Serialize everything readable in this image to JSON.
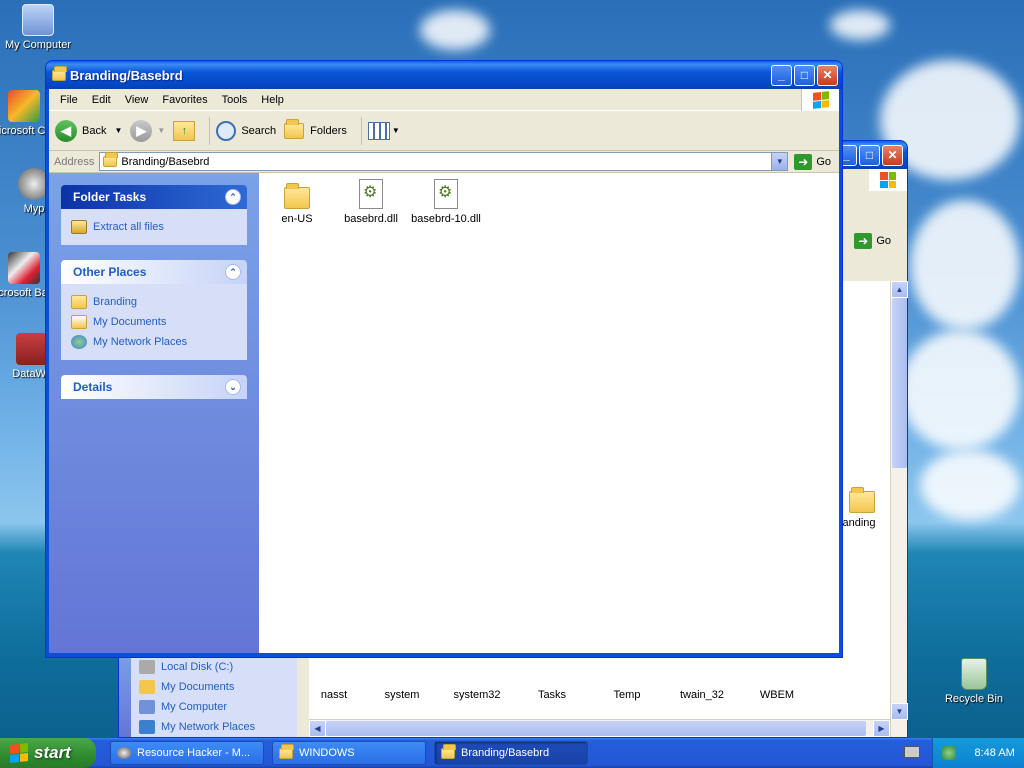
{
  "desktop": {
    "icons": [
      {
        "label": "My Computer"
      },
      {
        "label": "Microsoft C++"
      },
      {
        "label": "Myp"
      },
      {
        "label": "Microsoft Basic"
      },
      {
        "label": "DataWa"
      },
      {
        "label": "Recycle Bin"
      }
    ]
  },
  "back_window": {
    "go_label": "Go",
    "left_links": [
      "Local Disk (C:)",
      "My Documents",
      "My Computer",
      "My Network Places"
    ],
    "row1": [
      "nasst",
      "system",
      "system32",
      "Tasks",
      "Temp",
      "twain_32",
      "WBEM"
    ],
    "side_item": "anding"
  },
  "window": {
    "title": "Branding/Basebrd",
    "menu": [
      "File",
      "Edit",
      "View",
      "Favorites",
      "Tools",
      "Help"
    ],
    "toolbar": {
      "back_label": "Back",
      "search_label": "Search",
      "folders_label": "Folders"
    },
    "address": {
      "label": "Address",
      "value": "Branding/Basebrd",
      "go_label": "Go"
    },
    "tasks": {
      "folder_tasks_title": "Folder Tasks",
      "folder_tasks_links": [
        "Extract all files"
      ],
      "other_places_title": "Other Places",
      "other_places_links": [
        "Branding",
        "My Documents",
        "My Network Places"
      ],
      "details_title": "Details"
    },
    "files": [
      {
        "name": "en-US",
        "type": "folder"
      },
      {
        "name": "basebrd.dll",
        "type": "dll"
      },
      {
        "name": "basebrd-10.dll",
        "type": "dll"
      }
    ]
  },
  "taskbar": {
    "start_label": "start",
    "tasks": [
      "Resource Hacker - M...",
      "WINDOWS",
      "Branding/Basebrd"
    ],
    "clock": "8:48 AM"
  }
}
